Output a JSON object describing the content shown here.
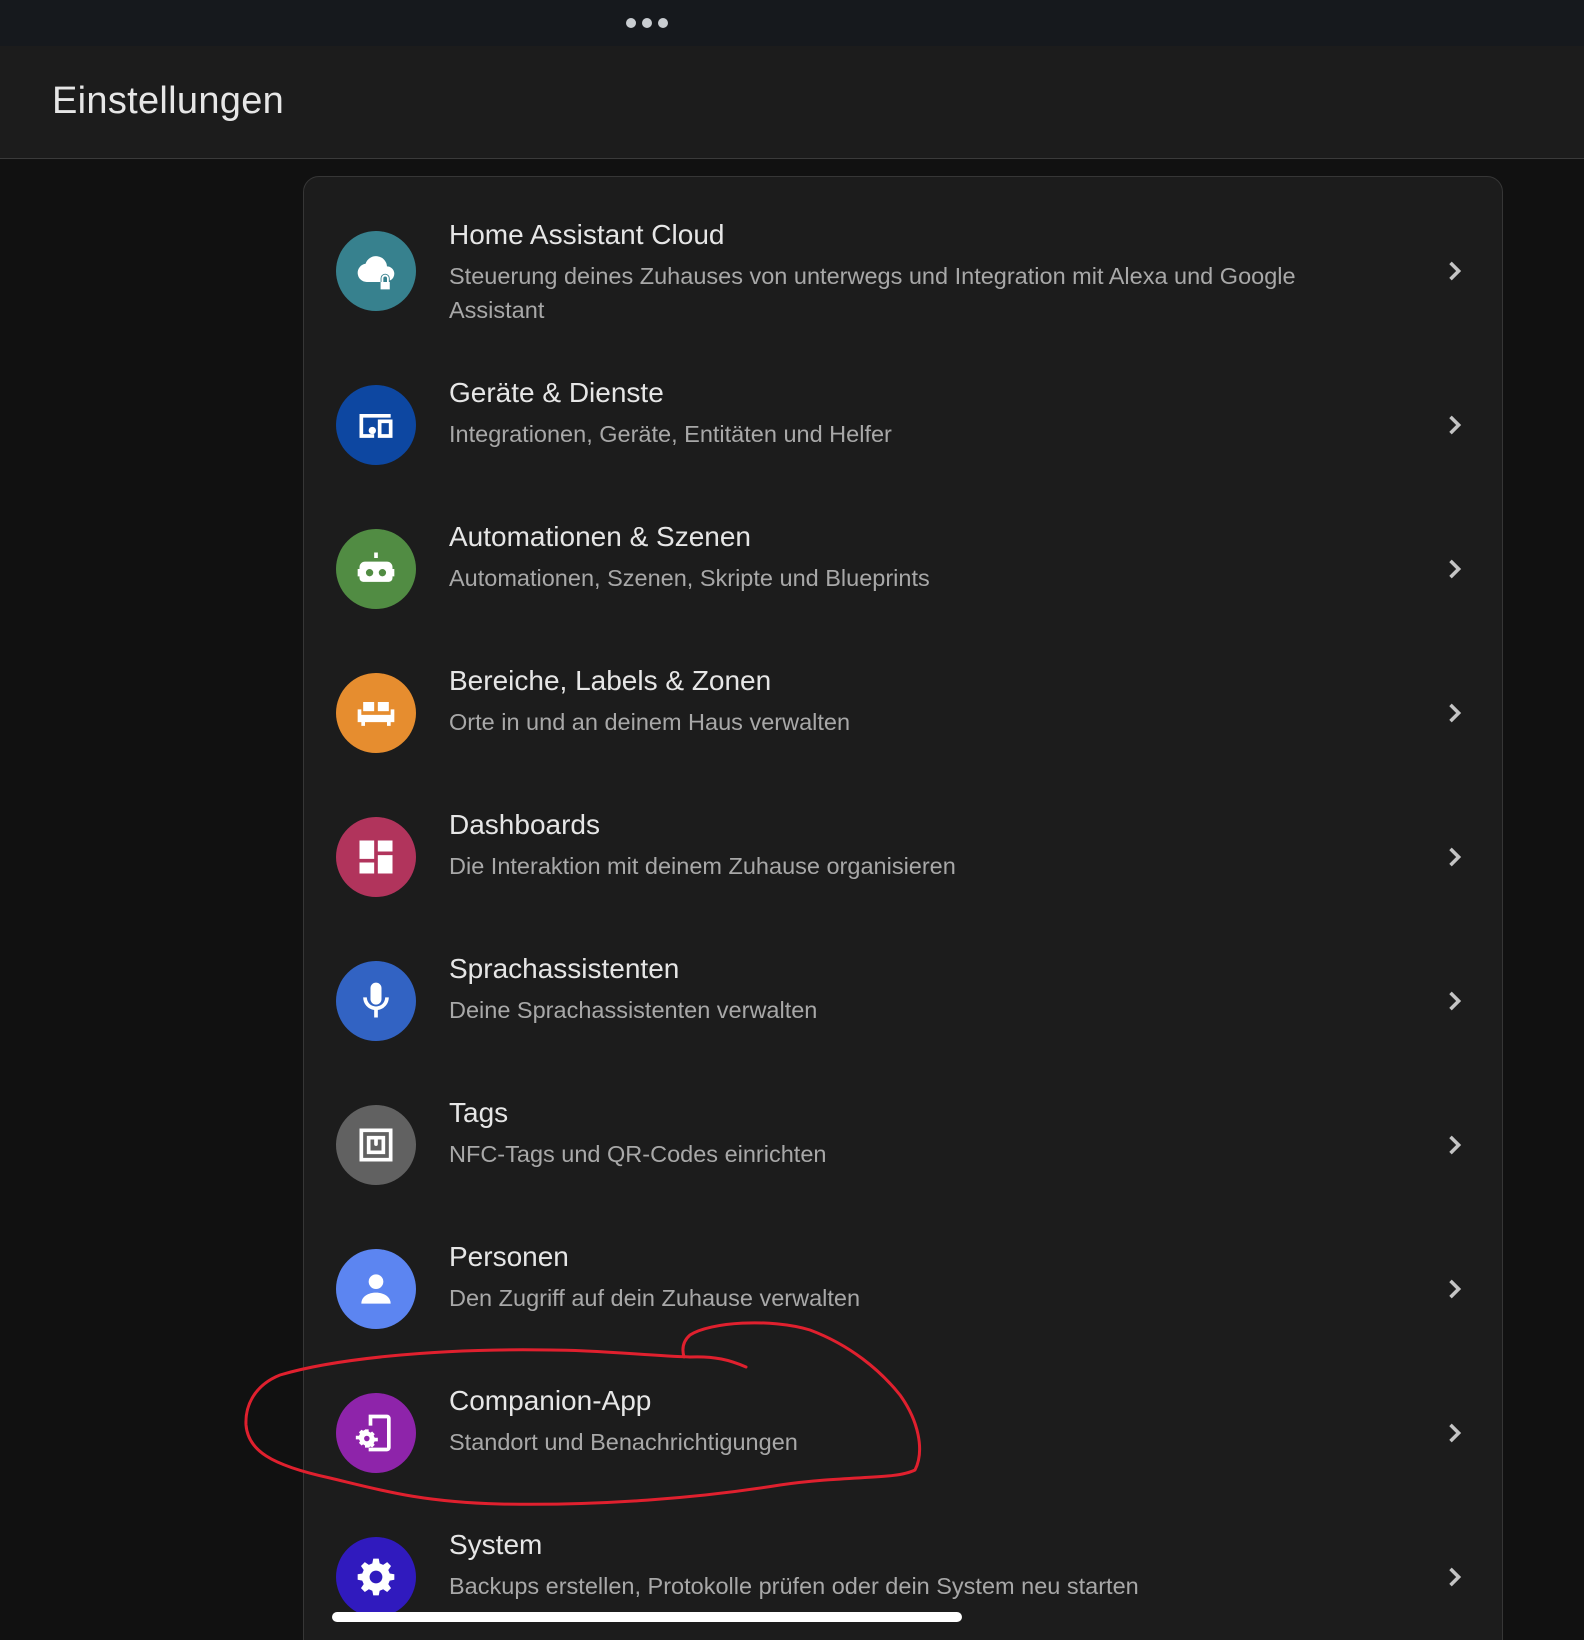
{
  "header": {
    "title": "Einstellungen"
  },
  "items": [
    {
      "title": "Home Assistant Cloud",
      "subtitle": "Steuerung deines Zuhauses von unterwegs und Integration mit Alexa und Google Assistant",
      "icon": "cloud-lock-icon",
      "color": "#37818e"
    },
    {
      "title": "Geräte & Dienste",
      "subtitle": "Integrationen, Geräte, Entitäten und Helfer",
      "icon": "devices-icon",
      "color": "#0d47a1"
    },
    {
      "title": "Automationen & Szenen",
      "subtitle": "Automationen, Szenen, Skripte und Blueprints",
      "icon": "robot-icon",
      "color": "#518c43"
    },
    {
      "title": "Bereiche, Labels & Zonen",
      "subtitle": "Orte in und an deinem Haus verwalten",
      "icon": "sofa-icon",
      "color": "#e68d2f"
    },
    {
      "title": "Dashboards",
      "subtitle": "Die Interaktion mit deinem Zuhause organisieren",
      "icon": "dashboard-icon",
      "color": "#b1345c"
    },
    {
      "title": "Sprachassistenten",
      "subtitle": "Deine Sprachassistenten verwalten",
      "icon": "microphone-icon",
      "color": "#3263c3"
    },
    {
      "title": "Tags",
      "subtitle": "NFC-Tags und QR-Codes einrichten",
      "icon": "nfc-tag-icon",
      "color": "#616161"
    },
    {
      "title": "Personen",
      "subtitle": "Den Zugriff auf dein Zuhause verwalten",
      "icon": "account-icon",
      "color": "#5c85f1"
    },
    {
      "title": "Companion-App",
      "subtitle": "Standort und Benachrichtigungen",
      "icon": "cellphone-cog-icon",
      "color": "#8e24aa"
    },
    {
      "title": "System",
      "subtitle": "Backups erstellen, Protokolle prüfen oder dein System neu starten",
      "icon": "cog-icon",
      "color": "#301ABE"
    }
  ],
  "annotation": {
    "color": "#e0202e"
  }
}
